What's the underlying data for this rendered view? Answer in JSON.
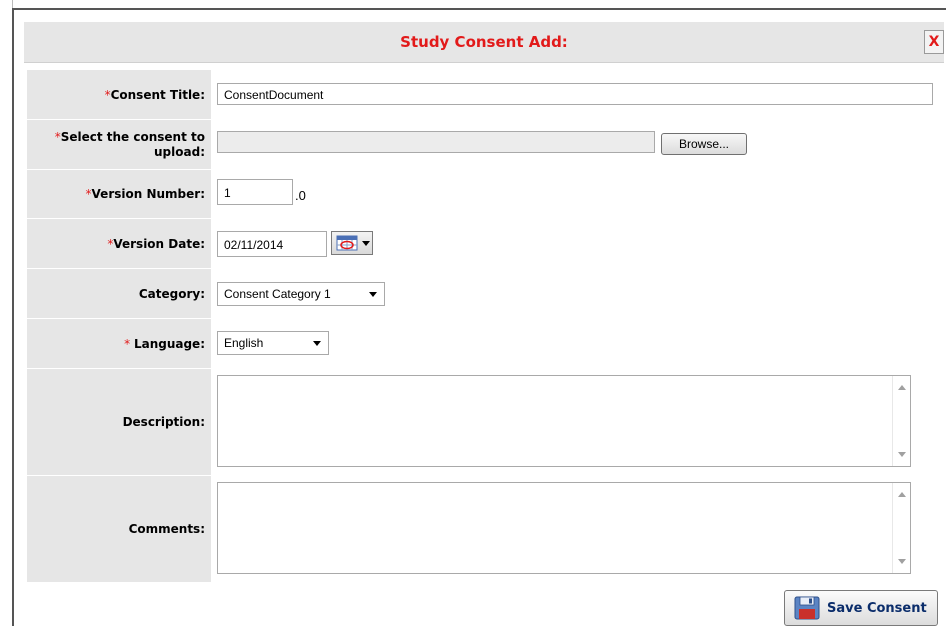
{
  "dialog": {
    "title": "Study Consent Add:",
    "close_label": "X"
  },
  "form": {
    "consent_title": {
      "required": "*",
      "label": "Consent Title:",
      "value": "ConsentDocument"
    },
    "upload": {
      "required": "*",
      "label": "Select the consent to upload:",
      "browse_label": "Browse..."
    },
    "version_number": {
      "required": "*",
      "label": "Version Number:",
      "value": "1",
      "suffix": ".0"
    },
    "version_date": {
      "required": "*",
      "label": "Version Date:",
      "value": "02/11/2014"
    },
    "category": {
      "label": "Category:",
      "selected": "Consent Category 1"
    },
    "language": {
      "required": "* ",
      "label": "Language:",
      "selected": "English"
    },
    "description": {
      "label": "Description:",
      "value": ""
    },
    "comments": {
      "label": "Comments:",
      "value": ""
    }
  },
  "actions": {
    "save_label": "Save Consent"
  },
  "icons": {
    "calendar": "calendar-icon",
    "save": "floppy-disk-icon"
  },
  "colors": {
    "required": "#e21a1a",
    "title": "#e21a1a",
    "label_bg": "#e6e6e6",
    "save_text": "#0b2d6b"
  }
}
